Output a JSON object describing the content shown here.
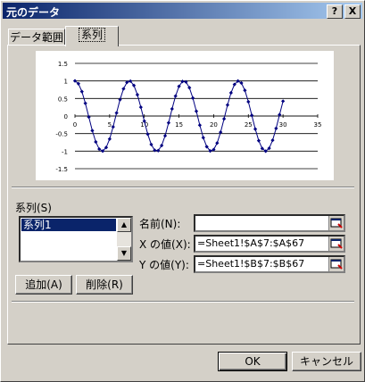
{
  "window": {
    "title": "元のデータ",
    "help": "?",
    "close": "X"
  },
  "tabs": [
    {
      "label": "データ範囲",
      "active": false
    },
    {
      "label": "系列",
      "active": true
    }
  ],
  "chart_data": {
    "type": "line",
    "x_start": 0,
    "x_step": 0.5,
    "x_count": 61,
    "y_function": "cos(x * 0.8)",
    "xlim": [
      0,
      35
    ],
    "ylim": [
      -1.5,
      1.5
    ],
    "xticks": [
      "0",
      "5",
      "10",
      "15",
      "20",
      "25",
      "30",
      "35"
    ],
    "yticks": [
      "1.5",
      "1",
      "0.5",
      "0",
      "-0.5",
      "-1",
      "-1.5"
    ],
    "line_color": "#000080",
    "grid": true
  },
  "series": {
    "section_label": "系列(S)",
    "items": [
      "系列1"
    ],
    "selected": "系列1"
  },
  "fields": {
    "name_label": "名前(N):",
    "name_value": "",
    "x_label": "X の値(X):",
    "x_value": "=Sheet1!$A$7:$A$67",
    "y_label": "Y の値(Y):",
    "y_value": "=Sheet1!$B$7:$B$67"
  },
  "buttons": {
    "add": "追加(A)",
    "delete": "削除(R)",
    "ok": "OK",
    "cancel": "キャンセル"
  }
}
